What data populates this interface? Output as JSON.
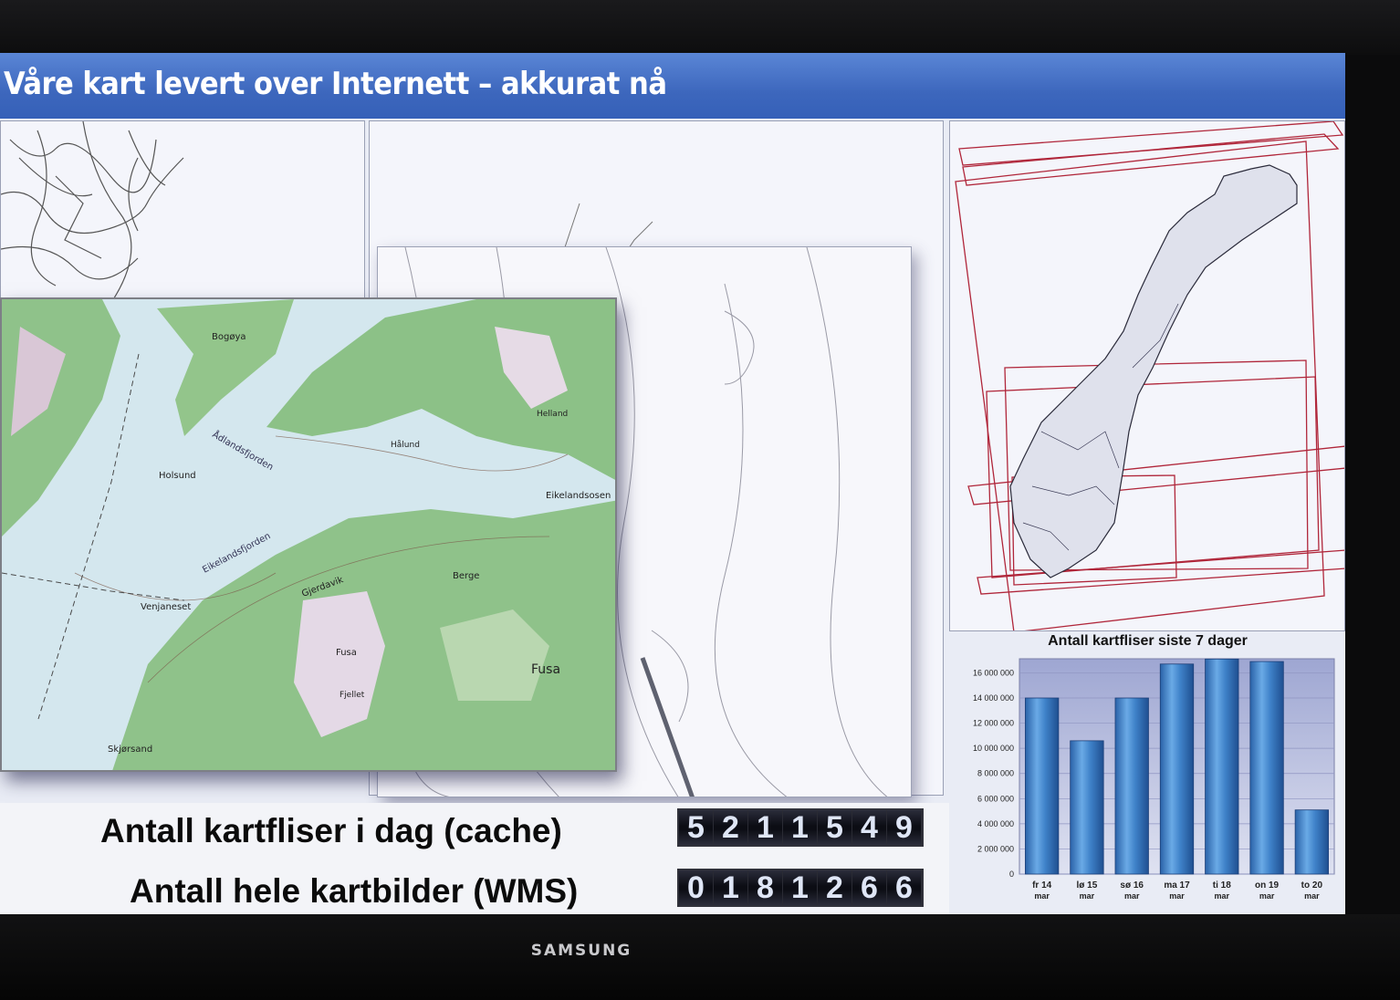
{
  "monitor": {
    "brand": "SAMSUNG"
  },
  "header": {
    "title": "Våre kart levert over Internett – akkurat nå"
  },
  "map_labels": {
    "bogoya": "Bogøya",
    "holsund": "Holsund",
    "aalandsfjorden": "Ådlandsfjorden",
    "eikelandsfjorden": "Eikelandsfjorden",
    "eikelandsosen": "Eikelandsosen",
    "venjaneset": "Venjaneset",
    "fusa": "Fusa",
    "fusa_town": "Fusa",
    "skjorsand": "Skjørsand",
    "berge": "Berge",
    "gjerdavik": "Gjerdavik",
    "hallund": "Hålund",
    "helland": "Helland",
    "fjellet": "Fjellet"
  },
  "counters": [
    {
      "label": "Antall kartfliser i dag (cache)",
      "digits": [
        "5",
        "2",
        "1",
        "1",
        "5",
        "4",
        "9"
      ]
    },
    {
      "label": "Antall hele kartbilder (WMS)",
      "digits": [
        "0",
        "1",
        "8",
        "1",
        "2",
        "6",
        "6"
      ]
    }
  ],
  "colors": {
    "title_bar": "#3d67bd",
    "bar": "#3f82c9",
    "norway_box": "#b0263a"
  },
  "chart_data": {
    "type": "bar",
    "title": "Antall kartfliser siste 7 dager",
    "categories": [
      [
        "fr 14",
        "mar"
      ],
      [
        "lø 15",
        "mar"
      ],
      [
        "sø 16",
        "mar"
      ],
      [
        "ma 17",
        "mar"
      ],
      [
        "ti 18",
        "mar"
      ],
      [
        "on 19",
        "mar"
      ],
      [
        "to 20",
        "mar"
      ]
    ],
    "values": [
      14000000,
      10600000,
      14000000,
      16700000,
      17100000,
      16900000,
      5100000
    ],
    "ylim": [
      0,
      16000000
    ],
    "yticks": [
      "0",
      "2 000 000",
      "4 000 000",
      "6 000 000",
      "8 000 000",
      "10 000 000",
      "12 000 000",
      "14 000 000",
      "16 000 000"
    ],
    "ytick_values": [
      0,
      2000000,
      4000000,
      6000000,
      8000000,
      10000000,
      12000000,
      14000000,
      16000000
    ],
    "xlabel": "",
    "ylabel": "",
    "grid": true
  }
}
